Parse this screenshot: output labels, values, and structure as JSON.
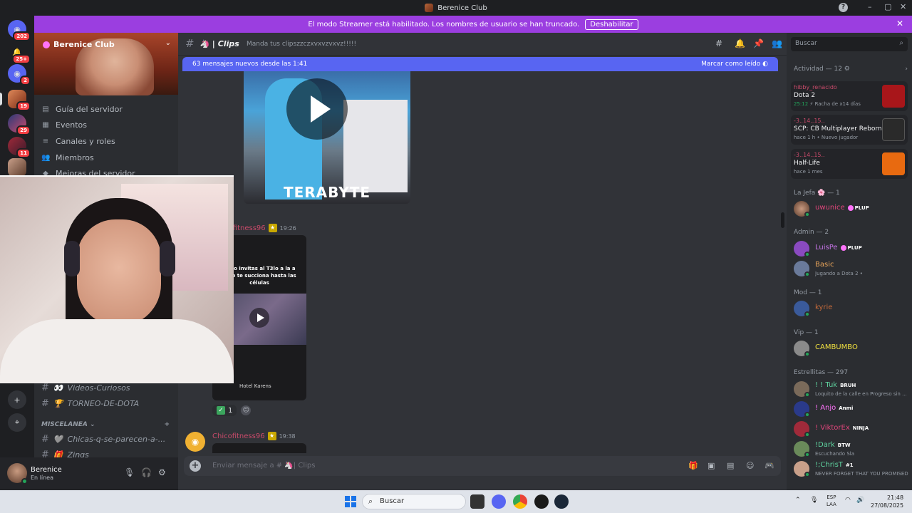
{
  "window": {
    "title": "Berenice Club"
  },
  "streamer_banner": {
    "message": "El modo Streamer está habilitado. Los nombres de usuario se han truncado.",
    "disable_label": "Deshabilitar"
  },
  "rail": {
    "home_badge": "202",
    "inbox_badge": "25+",
    "servers": [
      {
        "badge": "2"
      },
      {
        "badge": "19"
      },
      {
        "badge": "29"
      },
      {
        "badge": "11"
      }
    ]
  },
  "server": {
    "name": "Berenice Club",
    "nav": [
      {
        "label": "Guía del servidor",
        "icon": "guide-icon"
      },
      {
        "label": "Eventos",
        "icon": "calendar-icon"
      },
      {
        "label": "Canales y roles",
        "icon": "channels-icon"
      },
      {
        "label": "Miembros",
        "icon": "members-icon"
      },
      {
        "label": "Mejoras del servidor",
        "icon": "boost-icon"
      }
    ],
    "channels_top": [
      {
        "emoji": "👀",
        "name": "Videos-Curiosos"
      },
      {
        "emoji": "🏆",
        "name": "TORNEO-DE-DOTA"
      }
    ],
    "category": {
      "name": "MISCELANEA",
      "add": "+"
    },
    "channels_bottom": [
      {
        "emoji": "🩶",
        "name": "Chicas-q-se-parecen-a-..."
      },
      {
        "emoji": "🎁",
        "name": "Zings"
      }
    ]
  },
  "user": {
    "name": "Berenice",
    "status": "En línea"
  },
  "channel": {
    "name": "Clips",
    "topic": "Manda tus clipszzczxvxvzvxvz!!!!!",
    "new_messages": "63 mensajes nuevos desde las 1:41",
    "mark_read": "Marcar como leído"
  },
  "messages": {
    "video1_text": "TERABYTE",
    "msg2": {
      "author": "ifitness96",
      "time": "19:26",
      "caption": "ando invitas al T3lo a la a pero te succiona hasta las células",
      "logo": "Hotel Karens",
      "reaction_count": "1"
    },
    "msg3": {
      "author": "Chicofitness96",
      "time": "19:38"
    }
  },
  "composer": {
    "placeholder": "Enviar mensaje a #",
    "channel": "Clips"
  },
  "search": {
    "placeholder": "Buscar"
  },
  "activity": {
    "header": "Actividad — 12",
    "cards": [
      {
        "user": "hibby_renacido",
        "game": "Dota 2",
        "time": "25:12",
        "extra": "Racha de x14 días"
      },
      {
        "user": "-3..14..15..",
        "game": "SCP: CB Multiplayer Reborn",
        "time": "hace 1 h",
        "extra": "Nuevo jugador"
      },
      {
        "user": "-3..14..15..",
        "game": "Half-Life",
        "time": "hace 1 mes",
        "extra": ""
      }
    ]
  },
  "roles": [
    {
      "name": "La Jefa 🌸 — 1",
      "members": [
        {
          "name": "uwunice",
          "tag": "PLUP",
          "color": "#e0457b",
          "sub": ""
        }
      ]
    },
    {
      "name": "Admin — 2",
      "members": [
        {
          "name": "LuisPe",
          "tag": "PLUP",
          "color": "#c774e8",
          "sub": ""
        },
        {
          "name": "Basic",
          "tag": "",
          "color": "#e8a45a",
          "sub": "Jugando a Dota 2 •"
        }
      ]
    },
    {
      "name": "Mod — 1",
      "members": [
        {
          "name": "kyrie",
          "tag": "",
          "color": "#c56a3a",
          "sub": ""
        }
      ]
    },
    {
      "name": "Vip — 1",
      "members": [
        {
          "name": "CAMBUMBO",
          "tag": "",
          "color": "#f0e040",
          "sub": ""
        }
      ]
    },
    {
      "name": "Estrellitas — 297",
      "members": [
        {
          "name": "! ! Tuk",
          "tag": "BRUH",
          "color": "#5fd4a0",
          "sub": "Loquito de la calle en Progreso sin ..."
        },
        {
          "name": "! Anjo",
          "tag": "Anmi",
          "color": "#ff73fa",
          "sub": ""
        },
        {
          "name": "! ViktorEx",
          "tag": "NINJA",
          "color": "#e0457b",
          "sub": ""
        },
        {
          "name": "!Dark",
          "tag": "BTW",
          "color": "#5fd4a0",
          "sub": "Escuchando Sla"
        },
        {
          "name": "!;ChrisT",
          "tag": "#1",
          "color": "#5fd4a0",
          "sub": "NEVER FORGET THAT YOU PROMISED ..."
        }
      ]
    }
  ],
  "taskbar": {
    "search": "Buscar",
    "lang": "ESP",
    "lang2": "LAA",
    "time": "21:48",
    "date": "27/08/2025"
  },
  "colors": {
    "accent": "#5865f2",
    "banner": "#9b3ee0",
    "online": "#23a55a"
  }
}
